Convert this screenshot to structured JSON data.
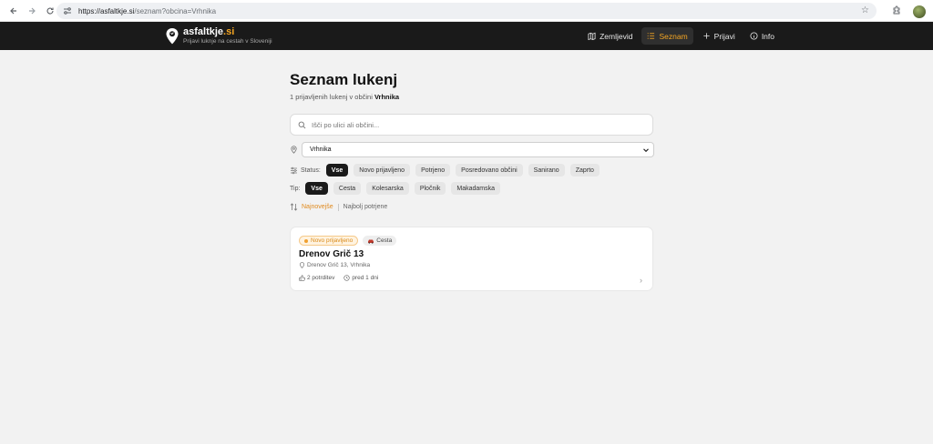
{
  "browser": {
    "url_host": "https://asfaltkje.si",
    "url_rest": "/seznam?obcina=Vrhnika",
    "back_icon": "arrow-left-icon",
    "forward_icon": "arrow-right-icon",
    "reload_icon": "reload-icon"
  },
  "header": {
    "brand_name": "asfaltkje",
    "brand_tld": ".si",
    "tagline": "Prijavi luknje na cestah v Sloveniji",
    "nav": [
      {
        "label": "Zemljevid",
        "icon": "map-icon",
        "active": false
      },
      {
        "label": "Seznam",
        "icon": "list-icon",
        "active": true
      },
      {
        "label": "Prijavi",
        "icon": "plus-icon",
        "active": false
      },
      {
        "label": "Info",
        "icon": "info-icon",
        "active": false
      }
    ]
  },
  "page": {
    "title": "Seznam lukenj",
    "subtitle_prefix": "1 prijavljenih lukenj v občini ",
    "subtitle_municipality": "Vrhnika",
    "search_placeholder": "Išči po ulici ali občini...",
    "municipality_selected": "Vrhnika",
    "status_label": "Status:",
    "status_filters": [
      "Vse",
      "Novo prijavljeno",
      "Potrjeno",
      "Posredovano občini",
      "Sanirano",
      "Zaprto"
    ],
    "type_label": "Tip:",
    "type_filters": [
      "Vse",
      "Cesta",
      "Kolesarska",
      "Pločnik",
      "Makadamska"
    ],
    "sort_active": "Najnovejše",
    "sort_other": "Najbolj potrjene"
  },
  "report": {
    "status_badge": "Novo prijavljeno",
    "type_badge": "Cesta",
    "title": "Drenov Grič 13",
    "address": "Drenov Grič 13, Vrhnika",
    "confirmations": "2 potrditev",
    "age": "pred 1 dni"
  },
  "colors": {
    "accent": "#f5a623",
    "header_bg": "#1a1a1a",
    "page_bg": "#f2f2f2"
  }
}
